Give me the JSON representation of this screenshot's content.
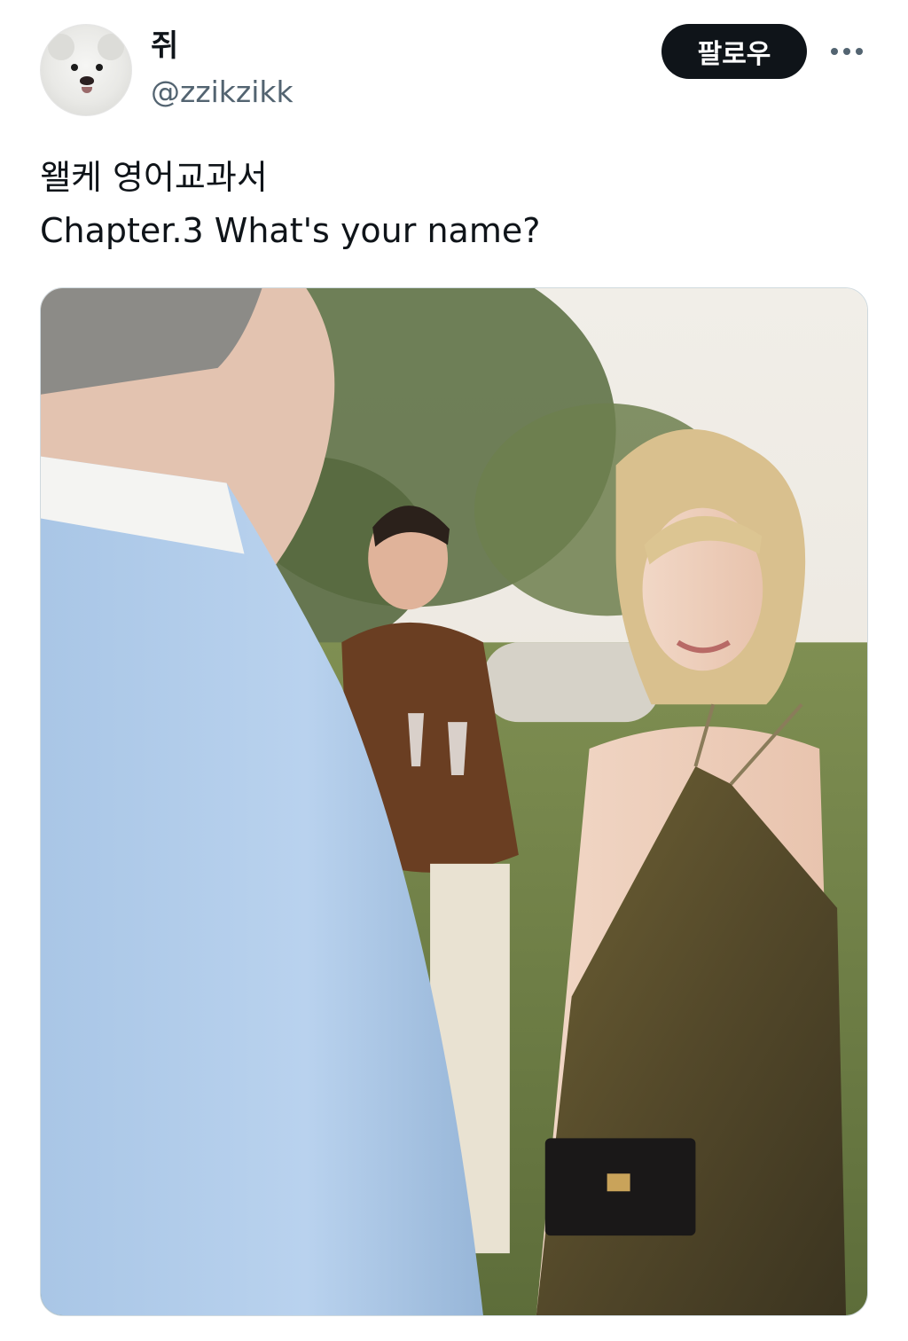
{
  "author": {
    "display_name": "쥐",
    "handle": "@zzikzikk",
    "avatar_icon": "puppy-avatar"
  },
  "actions": {
    "follow_label": "팔로우",
    "more_icon": "more-horizontal-icon"
  },
  "tweet": {
    "lines": [
      "왤케 영어교과서",
      "Chapter.3 What's your name?"
    ]
  },
  "colors": {
    "text_primary": "#0f1419",
    "text_secondary": "#536471",
    "button_bg": "#0f1419",
    "button_text": "#ffffff",
    "border": "#cfd9de"
  }
}
